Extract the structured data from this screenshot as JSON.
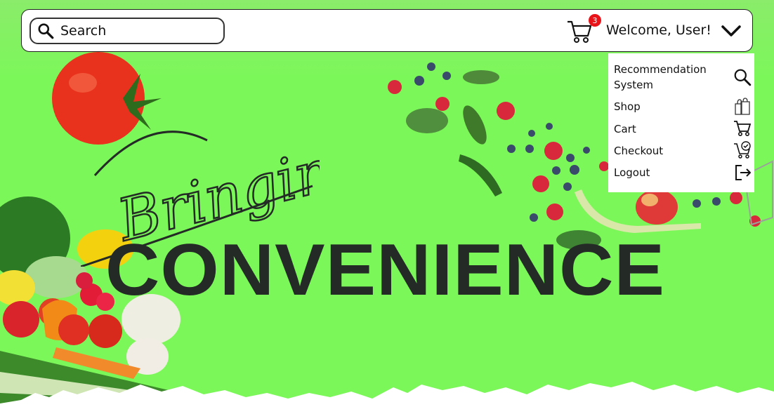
{
  "search": {
    "placeholder": "Search",
    "value": ""
  },
  "header": {
    "cart_count": "3",
    "welcome_text": "Welcome, User!"
  },
  "menu": {
    "items": [
      {
        "label": "Recommendation System",
        "icon": "search-icon"
      },
      {
        "label": "Shop",
        "icon": "shopping-bags-icon"
      },
      {
        "label": "Cart",
        "icon": "cart-icon"
      },
      {
        "label": "Checkout",
        "icon": "cart-check-icon"
      },
      {
        "label": "Logout",
        "icon": "logout-icon"
      }
    ]
  },
  "hero": {
    "script_word": "Bringing",
    "headline": "CONVENIENCE"
  },
  "colors": {
    "background": "#7cf75a",
    "headline": "#242b26",
    "badge": "#e8141a"
  }
}
